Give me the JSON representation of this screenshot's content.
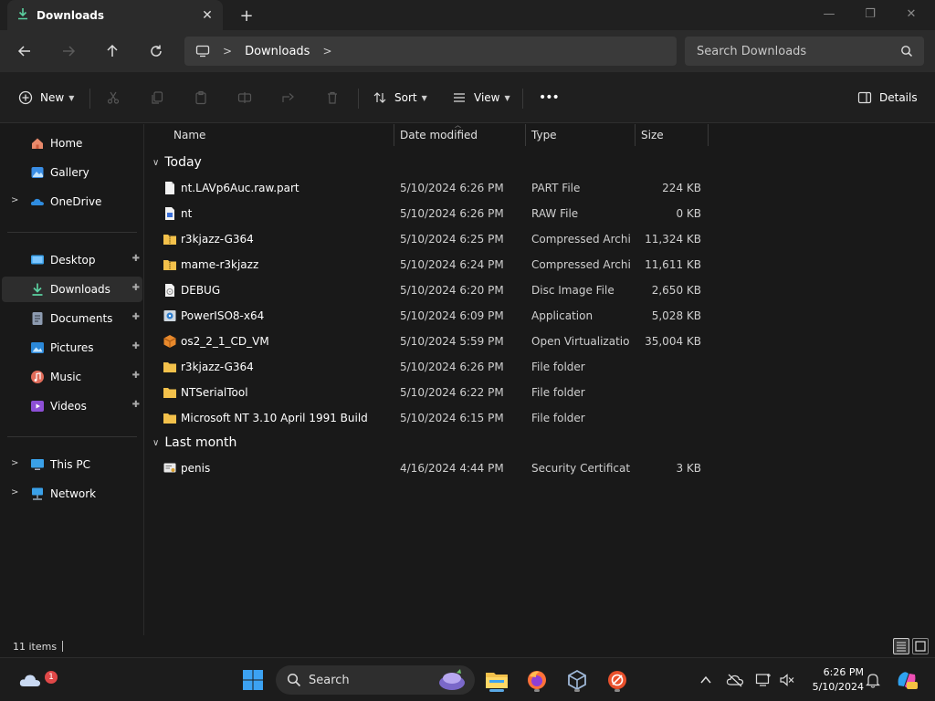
{
  "window": {
    "tab_title": "Downloads",
    "new_tab": "+",
    "close_tab": "✕",
    "minimize": "—",
    "maximize": "❐",
    "close": "✕"
  },
  "address": {
    "breadcrumb": "Downloads",
    "search_placeholder": "Search Downloads"
  },
  "commandbar": {
    "new_label": "New",
    "sort_label": "Sort",
    "view_label": "View",
    "more_label": "•••",
    "details_label": "Details"
  },
  "sidebar": {
    "items": [
      {
        "label": "Home",
        "icon": "home-icon"
      },
      {
        "label": "Gallery",
        "icon": "gallery-icon"
      },
      {
        "label": "OneDrive",
        "icon": "onedrive-icon"
      },
      {
        "label": "Desktop",
        "icon": "desktop-icon"
      },
      {
        "label": "Downloads",
        "icon": "download-icon"
      },
      {
        "label": "Documents",
        "icon": "documents-icon"
      },
      {
        "label": "Pictures",
        "icon": "pictures-icon"
      },
      {
        "label": "Music",
        "icon": "music-icon"
      },
      {
        "label": "Videos",
        "icon": "videos-icon"
      },
      {
        "label": "This PC",
        "icon": "pc-icon"
      },
      {
        "label": "Network",
        "icon": "network-icon"
      }
    ],
    "pin_glyph": "📌"
  },
  "columns": {
    "name": "Name",
    "date": "Date modified",
    "type": "Type",
    "size": "Size"
  },
  "groups": {
    "today": "Today",
    "last_month": "Last month"
  },
  "files": [
    {
      "name": "nt.LAVp6Auc.raw.part",
      "date": "5/10/2024 6:26 PM",
      "type": "PART File",
      "size": "224 KB",
      "icon": "file-icon"
    },
    {
      "name": "nt",
      "date": "5/10/2024 6:26 PM",
      "type": "RAW File",
      "size": "0 KB",
      "icon": "raw-file-icon"
    },
    {
      "name": "r3kjazz-G364",
      "date": "5/10/2024 6:25 PM",
      "type": "Compressed Archi...",
      "size": "11,324 KB",
      "icon": "zip-folder-icon"
    },
    {
      "name": "mame-r3kjazz",
      "date": "5/10/2024 6:24 PM",
      "type": "Compressed Archi...",
      "size": "11,611 KB",
      "icon": "zip-folder-icon"
    },
    {
      "name": "DEBUG",
      "date": "5/10/2024 6:20 PM",
      "type": "Disc Image File",
      "size": "2,650 KB",
      "icon": "disc-image-icon"
    },
    {
      "name": "PowerISO8-x64",
      "date": "5/10/2024 6:09 PM",
      "type": "Application",
      "size": "5,028 KB",
      "icon": "installer-icon"
    },
    {
      "name": "os2_2_1_CD_VM",
      "date": "5/10/2024 5:59 PM",
      "type": "Open Virtualizatio...",
      "size": "35,004 KB",
      "icon": "virtualbox-package-icon"
    },
    {
      "name": "r3kjazz-G364",
      "date": "5/10/2024 6:26 PM",
      "type": "File folder",
      "size": "",
      "icon": "folder-icon"
    },
    {
      "name": "NTSerialTool",
      "date": "5/10/2024 6:22 PM",
      "type": "File folder",
      "size": "",
      "icon": "folder-icon"
    },
    {
      "name": "Microsoft NT 3.10 April 1991 Build",
      "date": "5/10/2024 6:15 PM",
      "type": "File folder",
      "size": "",
      "icon": "folder-icon"
    },
    {
      "name": "penis",
      "date": "4/16/2024 4:44 PM",
      "type": "Security Certificate",
      "size": "3 KB",
      "icon": "certificate-icon"
    }
  ],
  "status": {
    "item_count": "11 items"
  },
  "taskbar": {
    "search_label": "Search",
    "weather_badge": "1",
    "time": "6:26 PM",
    "date": "5/10/2024"
  },
  "colors": {
    "folder": "#f3c14b",
    "accent": "#4cc2ff",
    "selected_bg": "#2d2d2d"
  }
}
